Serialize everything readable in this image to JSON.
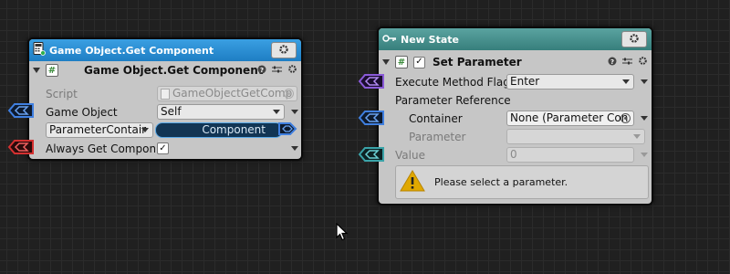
{
  "node_get_component": {
    "title": "Game Object.Get Component",
    "component_title": "Game Object.Get Component",
    "script_label": "Script",
    "script_value": "GameObjectGetComp",
    "game_object_label": "Game Object",
    "game_object_value": "Self",
    "parameter_dropdown": "ParameterContair",
    "component_output": "Component",
    "always_get_label": "Always Get Compone",
    "always_get_checked": "✓",
    "colors": {
      "title": "#2a8fd6",
      "port_blue": "#3f7fe0",
      "port_red": "#d43030"
    }
  },
  "node_new_state": {
    "title": "New State",
    "component_title": "Set Parameter",
    "enabled_check": "✓",
    "execute_label": "Execute Method Flag",
    "execute_value": "Enter",
    "param_ref_label": "Parameter Reference",
    "container_label": "Container",
    "container_value": "None (Parameter Con",
    "parameter_label": "Parameter",
    "parameter_value": "",
    "value_label": "Value",
    "value_value": "0",
    "warning_text": "Please select a parameter.",
    "colors": {
      "title": "#4a9390",
      "port_purple": "#8a5ad8",
      "port_blue": "#3f7fe0",
      "port_teal": "#3aa3a8"
    }
  }
}
